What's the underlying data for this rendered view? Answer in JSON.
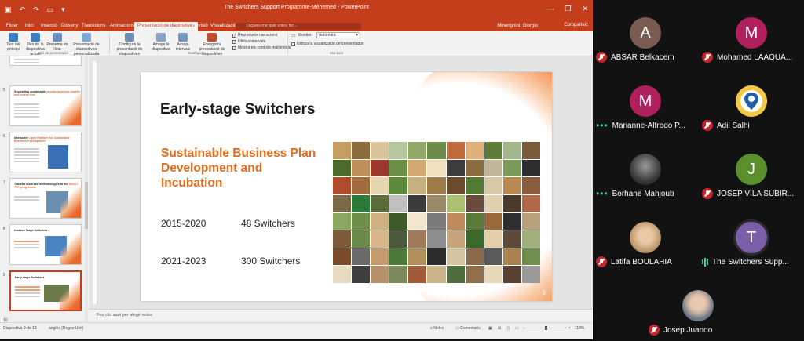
{
  "powerpoint": {
    "title_bar": {
      "document_title": "The Switchers Support Programme-Méhemed - PowerPoint"
    },
    "tabs": [
      "Fitxer",
      "Inici",
      "Inserció",
      "Disseny",
      "Transicions",
      "Animacions",
      "Presentació de diapositives",
      "Revisió",
      "Visualització"
    ],
    "active_tab": "Presentació de diapositives",
    "search_placeholder": "Digueu-me què voleu fer...",
    "user_name": "Minenghini, Giorgio",
    "share_label": "Comparteix",
    "ribbon": {
      "buttons": [
        {
          "label": "Des del principi",
          "color": "#3d7cc9"
        },
        {
          "label": "Des de la diapositiva actual",
          "color": "#3d7cc9"
        },
        {
          "label": "Presenta en línia",
          "color": "#6a8fc0"
        },
        {
          "label": "Presentació de diapositives personalitzada",
          "color": "#7fa7d6"
        },
        {
          "label": "Configura la presentació de diapositives",
          "color": "#6d8fb7"
        },
        {
          "label": "Amaga la diapositiva",
          "color": "#8aa2c2"
        },
        {
          "label": "Assaja intervals",
          "color": "#7796c0"
        },
        {
          "label": "Enregistra presentació de diapositives",
          "color": "#c24b2f"
        }
      ],
      "checks": [
        "Reprodueix narracions",
        "Utilitza intervals",
        "Mostra els controls multimèdia"
      ],
      "monitor_label": "Monitor:",
      "monitor_value": "Automàtic",
      "presenter_view": "Utilitza la visualització del presentador",
      "groups": [
        "Inici de presentació",
        "Configura",
        "Monitors"
      ]
    },
    "thumbnails": [
      {
        "num": "",
        "title": "",
        "title_or": ""
      },
      {
        "num": "5",
        "title": "Supporting sustainable ",
        "title_or": "circular business models and enterprises"
      },
      {
        "num": "6",
        "title": "Interactive ",
        "title_or": "Open Platform for Sustainable Business Development"
      },
      {
        "num": "7",
        "title": "Transfer tools and methodologies to the ",
        "title_or": "BSOs / TOT programme"
      },
      {
        "num": "8",
        "title": "Ideation Stage Switchers",
        "title_or": ""
      },
      {
        "num": "9",
        "title": "Early-stage Switchers",
        "title_or": ""
      }
    ],
    "slide": {
      "title": "Early-stage Switchers",
      "subtitle": "Sustainable Business Plan Development and Incubation",
      "rows": [
        {
          "period": "2015-2020",
          "value": "48 Switchers"
        },
        {
          "period": "2021-2023",
          "value": "300 Switchers"
        }
      ],
      "page_number": "9"
    },
    "notes_placeholder": "Feu clic aquí per afegir notes",
    "status": {
      "slide_counter": "Diapositiva 9 de 13",
      "language": "anglès (Regne Unit)",
      "notes_button": "Notes",
      "comments_button": "Comentaris",
      "zoom": "119%"
    }
  },
  "participants": [
    {
      "name": "ABSAR Belkacem",
      "initial": "A",
      "avatar_color": "#7a5b4f",
      "status": "muted",
      "photo": false
    },
    {
      "name": "Mohamed LAAOUA...",
      "initial": "M",
      "avatar_color": "#b0205c",
      "status": "muted",
      "photo": false
    },
    {
      "name": "Marianne-Alfredo P...",
      "initial": "M",
      "avatar_color": "#b0205c",
      "status": "dots",
      "photo": false
    },
    {
      "name": "Adil Salhi",
      "initial": "",
      "avatar_color": "#f5c842",
      "status": "muted",
      "photo": true
    },
    {
      "name": "Borhane Mahjoub",
      "initial": "",
      "avatar_color": "#555555",
      "status": "dots",
      "photo": true
    },
    {
      "name": "JOSEP VILA SUBIR...",
      "initial": "J",
      "avatar_color": "#5b8f2d",
      "status": "muted",
      "photo": false
    },
    {
      "name": "Latifa BOULAHIA",
      "initial": "",
      "avatar_color": "#c9a57a",
      "status": "muted",
      "photo": true
    },
    {
      "name": "The Switchers Supp...",
      "initial": "T",
      "avatar_color": "#7a5fa8",
      "status": "speaking",
      "photo": false
    },
    {
      "name": "Josep Juando",
      "initial": "",
      "avatar_color": "#8a8a8a",
      "status": "muted",
      "photo": true
    }
  ],
  "collage_colors": [
    "#c79e62",
    "#8b6a3e",
    "#d9c39a",
    "#b5c7a1",
    "#94a86c",
    "#6d8a4a",
    "#c06a3b",
    "#e0b07a",
    "#5f7b3a",
    "#a3b58a",
    "#7a5c3a",
    "#4a6b2a",
    "#bf8f5a",
    "#9b3a2c",
    "#6b8f47",
    "#d2a873",
    "#f0e0c0",
    "#3c3c3c",
    "#8b6a3e",
    "#c2b59a",
    "#7a9a5a",
    "#2e2e2e",
    "#b04a2a",
    "#a06a3a",
    "#e8d6b0",
    "#5a8a3a",
    "#c7b080",
    "#9f7a4a",
    "#6c4a2a",
    "#4f7a2f",
    "#d7c9a5",
    "#b9884f",
    "#8a5a3a",
    "#7a6a4a",
    "#2a7a3a",
    "#5a6a3a",
    "#c0c0c0",
    "#3a3a3a",
    "#9b8a6a",
    "#a8c070",
    "#6a4a3a",
    "#e0d0b0",
    "#4a3a2a",
    "#b06a4a",
    "#8aa860",
    "#6e8f4a",
    "#d0b080",
    "#3c5a2a",
    "#f2e6cc",
    "#7a7a7a",
    "#c08a5a",
    "#5a7a3a",
    "#9a6a3a",
    "#2f2f2f",
    "#b7a07a",
    "#7e5a3a",
    "#6a8a4a",
    "#d9b68a",
    "#4a5a3a",
    "#a07a5a",
    "#8e8e8e",
    "#c6a37a",
    "#3a6a2a",
    "#e4cfa8",
    "#5f4a3a",
    "#9fb07a",
    "#7a4a2a",
    "#6a6a6a",
    "#c49a6a",
    "#4a7a3a",
    "#b0905a",
    "#2c2c2c",
    "#d6c4a0",
    "#8a6a4a",
    "#5a5a5a",
    "#aa8050",
    "#6f8f4f",
    "#e7dcc2",
    "#3f3f3f",
    "#b59068",
    "#7a8a5a",
    "#a25a3a",
    "#cbb38a",
    "#4e6e3e",
    "#916e4a",
    "#e9d8b8",
    "#5a4030",
    "#9a9a9a"
  ]
}
